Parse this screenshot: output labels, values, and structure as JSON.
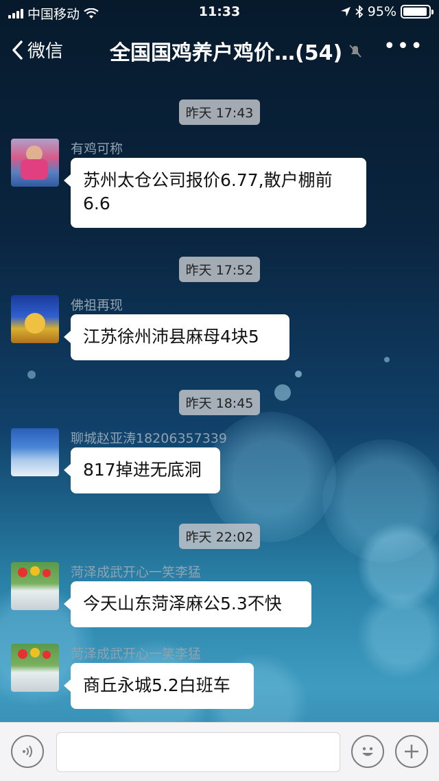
{
  "status_bar": {
    "carrier": "中国移动",
    "time": "11:33",
    "battery": "95%"
  },
  "nav": {
    "back_label": "微信",
    "title": "全国国鸡养户鸡价…(54)",
    "more_label": "•••"
  },
  "timestamps": [
    "昨天 17:43",
    "昨天 17:52",
    "昨天 18:45",
    "昨天 22:02"
  ],
  "messages": [
    {
      "sender": "有鸡可称",
      "lines": [
        "苏州太仓公司报价6.77,散户棚前",
        "6.6"
      ]
    },
    {
      "sender": "佛祖再现",
      "lines": [
        "江苏徐州沛县麻母4块5"
      ]
    },
    {
      "sender": "聊城赵亚涛18206357339",
      "lines": [
        "817掉进无底洞"
      ]
    },
    {
      "sender": "菏泽成武开心一笑李猛",
      "lines": [
        "今天山东菏泽麻公5.3不快"
      ]
    },
    {
      "sender": "菏泽成武开心一笑李猛",
      "lines": [
        "商丘永城5.2白班车"
      ]
    }
  ],
  "input_bar": {
    "voice_icon": "voice-icon",
    "emoji_icon": "emoji-icon",
    "plus_icon": "plus-icon",
    "text_value": ""
  }
}
